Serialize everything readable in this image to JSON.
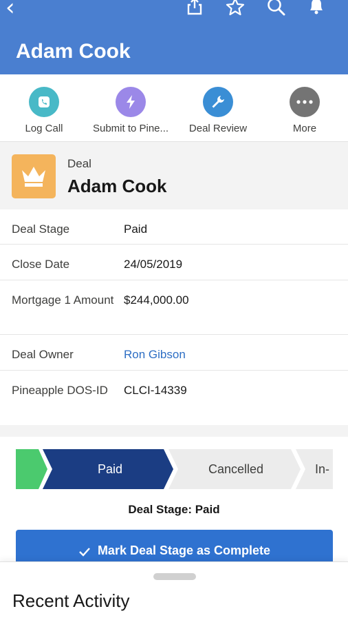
{
  "header": {
    "title": "Adam Cook",
    "bg_color": "#4a7fd0",
    "icons": [
      "back-icon",
      "share-icon",
      "star-icon",
      "search-icon",
      "bell-icon"
    ]
  },
  "actions": [
    {
      "label": "Log Call",
      "icon": "phone-icon",
      "color": "#48b9c7"
    },
    {
      "label": "Submit to Pine...",
      "icon": "lightning-icon",
      "color": "#9b88e8"
    },
    {
      "label": "Deal Review",
      "icon": "wrench-icon",
      "color": "#3a8ed5"
    },
    {
      "label": "More",
      "icon": "more-icon",
      "color": "#747474"
    }
  ],
  "record": {
    "type": "Deal",
    "name": "Adam Cook",
    "icon": "crown-icon",
    "icon_color": "#f4b45c"
  },
  "fields": [
    {
      "key": "Deal Stage",
      "value": "Paid"
    },
    {
      "key": "Close Date",
      "value": "24/05/2019"
    },
    {
      "key": "Mortgage 1 Amount",
      "value": "$244,000.00"
    },
    {
      "key": "Deal Owner",
      "value": "Ron Gibson"
    },
    {
      "key": "Pineapple DOS-ID",
      "value": "CLCI-14339"
    }
  ],
  "path": {
    "stages": [
      "Paid",
      "Cancelled",
      "In-"
    ],
    "current": "Paid",
    "current_label": "Deal Stage: Paid",
    "colors": {
      "complete": "#4bca6e",
      "current": "#1b3d83",
      "pending": "#ececec"
    }
  },
  "mark_button": {
    "label": "Mark Deal Stage as Complete"
  },
  "recent": {
    "title": "Recent Activity"
  }
}
